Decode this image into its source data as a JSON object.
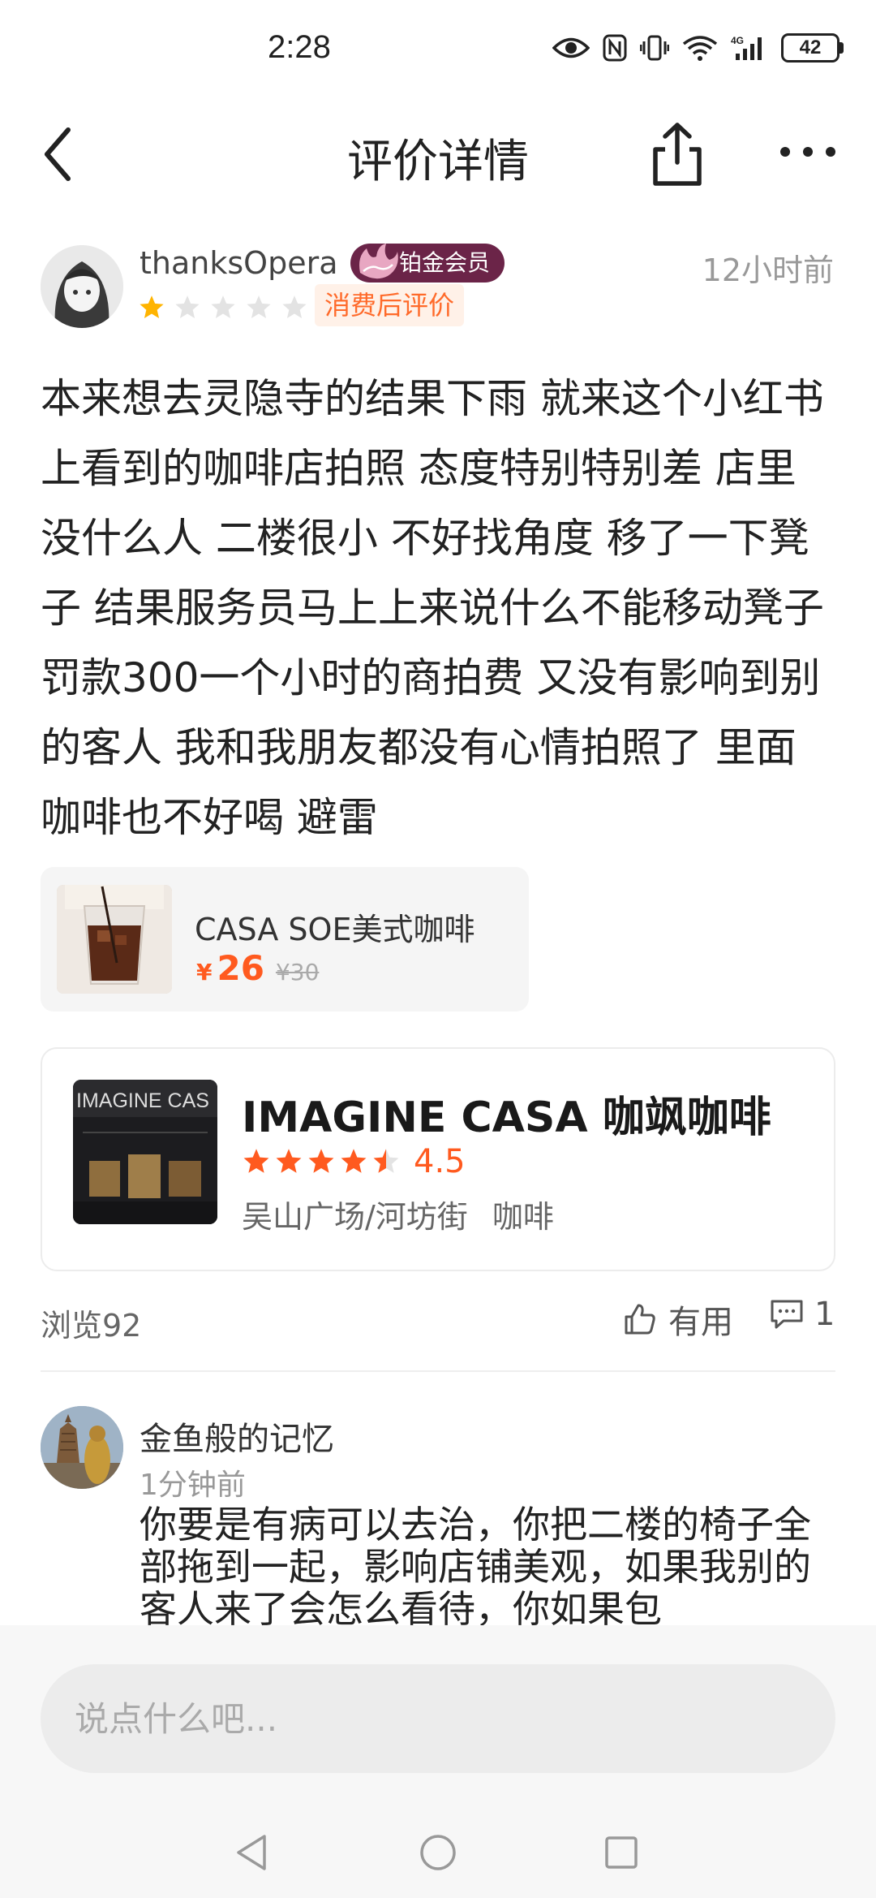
{
  "status_bar": {
    "time": "2:28",
    "battery": "42"
  },
  "header": {
    "title": "评价详情"
  },
  "review": {
    "username": "thanksOpera",
    "member_badge": "铂金会员",
    "time_ago": "12小时前",
    "rating": 1,
    "rating_max": 5,
    "tag": "消费后评价",
    "text": "本来想去灵隐寺的结果下雨 就来这个小红书上看到的咖啡店拍照 态度特别特别差 店里没什么人 二楼很小 不好找角度 移了一下凳子 结果服务员马上上来说什么不能移动凳子罚款300一个小时的商拍费 又没有影响到别的客人 我和我朋友都没有心情拍照了 里面咖啡也不好喝 避雷"
  },
  "product": {
    "name": "CASA SOE美式咖啡",
    "currency": "¥",
    "price": "26",
    "original_price": "¥30"
  },
  "shop": {
    "name": "IMAGINE CASA 咖飒咖啡",
    "rating": "4.5",
    "rating_value": 4.5,
    "location": "吴山广场/河坊街",
    "category": "咖啡",
    "sign_text": "IMAGINE CAS"
  },
  "stats": {
    "views": "浏览92",
    "useful_label": "有用",
    "comment_count": "1"
  },
  "comment": {
    "name": "金鱼般的记忆",
    "time": "1分钟前",
    "text": "你要是有病可以去治，你把二楼的椅子全部拖到一起，影响店铺美观，如果我别的客人来了会怎么看待，你如果包"
  },
  "input": {
    "placeholder": "说点什么吧..."
  },
  "colors": {
    "accent": "#ff5a1f",
    "star_active": "#ffb400",
    "badge": "#6b2448"
  }
}
